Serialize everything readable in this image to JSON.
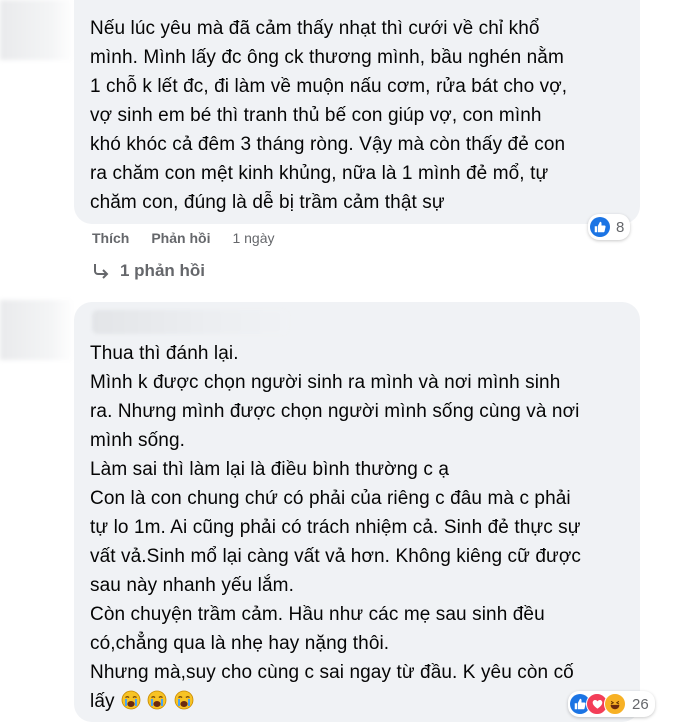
{
  "comment1": {
    "lines": [
      "Nếu lúc yêu mà đã cảm thấy nhạt thì cưới về chỉ khổ",
      "mình. Mình lấy đc ông ck thương mình, bầu nghén nằm",
      "1 chỗ k lết đc, đi làm về muộn nấu cơm, rửa bát cho vợ,",
      "vợ sinh em bé thì tranh thủ bế con giúp vợ, con mình",
      "khó khóc cả đêm 3 tháng ròng. Vậy mà còn thấy đẻ con",
      "ra chăm con mệt kinh khủng, nữa là 1 mình đẻ mổ, tự",
      "chăm con, đúng là dễ bị trầm cảm thật sự"
    ],
    "reaction_count": "8",
    "like_label": "Thích",
    "reply_label": "Phản hồi",
    "time": "1 ngày",
    "replies_label": "1 phản hồi"
  },
  "comment2": {
    "lines": [
      "Thua thì đánh lại.",
      "Mình k được chọn người sinh ra mình và nơi mình sinh",
      "ra. Nhưng mình được chọn người mình sống cùng và nơi",
      "mình sống.",
      "Làm sai thì làm lại là điều bình thường c ạ",
      "Con là con chung chứ có phải của riêng c đâu mà c phải",
      "tự lo 1m. Ai cũng phải có trách nhiệm cả. Sinh đẻ thực sự",
      "vất vả.Sinh mổ lại càng vất vả hơn. Không kiêng cữ được",
      "sau này nhanh yếu lắm.",
      "Còn chuyện trầm cảm. Hầu như các mẹ sau sinh đều",
      "có,chẳng qua là nhẹ hay nặng thôi.",
      "Nhưng mà,suy cho cùng c sai ngay từ đầu. K yêu còn cố",
      "lấy"
    ],
    "reaction_count": "26"
  },
  "colors": {
    "bubble": "#f0f2f5",
    "meta_text": "#65676b",
    "like_blue": "#1b74e4",
    "heart_red": "#f33e58",
    "haha_yellow": "#f7b125"
  },
  "icons": [
    "like-icon",
    "heart-icon",
    "haha-icon",
    "reply-arrow-icon",
    "crying-face-emoji"
  ]
}
